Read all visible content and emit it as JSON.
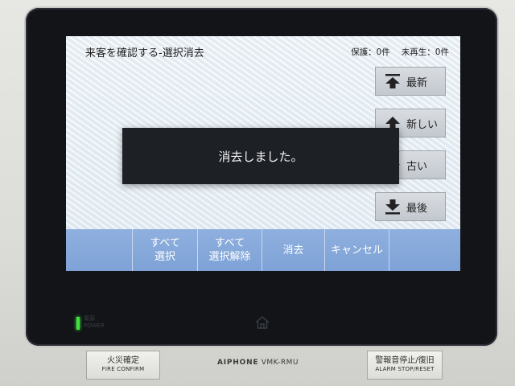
{
  "screen": {
    "title": "来客を確認する-選択消去",
    "protected_count": "保護：0件",
    "unplayed_count": "未再生：0件"
  },
  "nav": {
    "latest": "最新",
    "newer": "新しい",
    "older": "古い",
    "last": "最後"
  },
  "toast": {
    "message": "消去しました。"
  },
  "actions": {
    "select_all": "すべて\n選択",
    "deselect_all": "すべて\n選択解除",
    "delete": "消去",
    "cancel": "キャンセル"
  },
  "device": {
    "power_label_jp": "電源",
    "power_label_en": "POWER",
    "fire_confirm_jp": "火災確定",
    "fire_confirm_en": "FIRE CONFIRM",
    "brand": "AIPHONE",
    "model": "VMK-RMU",
    "alarm_stop_jp": "警報音停止/復旧",
    "alarm_stop_en": "ALARM STOP/RESET"
  },
  "colors": {
    "action_bar": "#7ea2d6",
    "toast_bg": "#1d2024",
    "power_led": "#3fe13d"
  },
  "icons": {
    "latest": "arrow-up-to-top-icon",
    "newer": "arrow-up-icon",
    "older": "arrow-down-icon",
    "last": "arrow-down-to-bottom-icon",
    "home": "home-icon"
  }
}
